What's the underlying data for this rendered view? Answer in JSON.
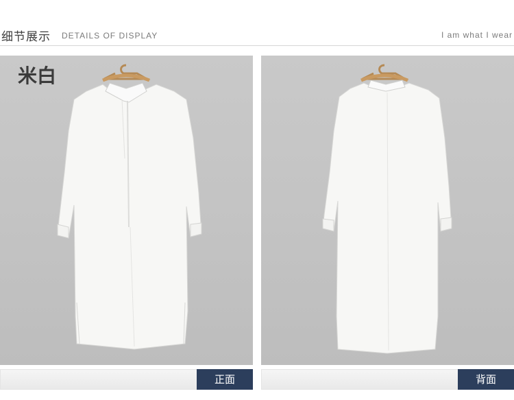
{
  "header": {
    "title_cn": "细节展示",
    "title_en": "DETAILS OF DISPLAY",
    "slogan": "I am what I wear"
  },
  "panels": [
    {
      "color_label": "米白",
      "caption": "正面"
    },
    {
      "color_label": "",
      "caption": "背面"
    }
  ],
  "colors": {
    "panel_bg": "#c6c6c6",
    "caption_tag_bg": "#2c3e5c",
    "caption_tag_text": "#ffffff",
    "garment": "#f7f7f5"
  }
}
